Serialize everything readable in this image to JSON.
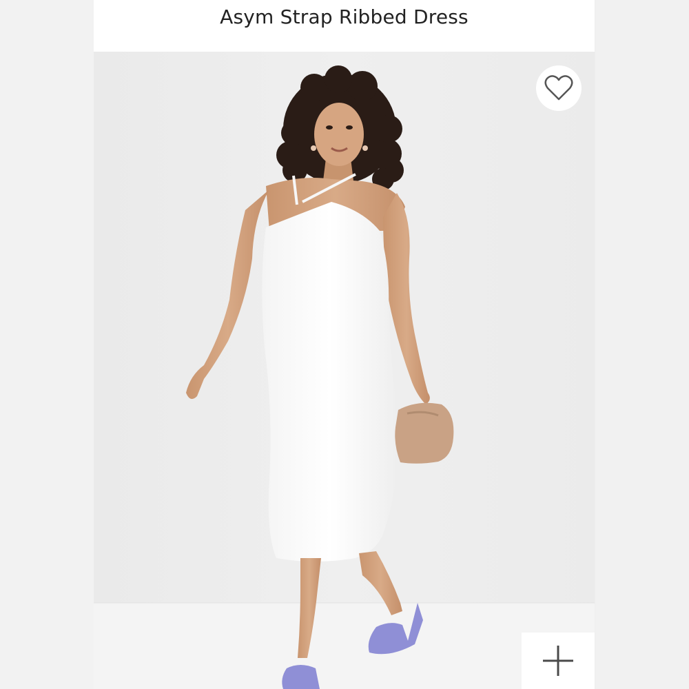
{
  "product": {
    "title": "Asym Strap Ribbed Dress"
  },
  "image": {
    "subject": "model-in-white-dress",
    "alt": ""
  },
  "favorite": {
    "icon": "heart-outline-icon",
    "selected": false
  },
  "zoom": {
    "icon": "plus-icon"
  },
  "colors": {
    "background": "#ececec",
    "card": "#ffffff",
    "title_text": "#222222",
    "icon_stroke": "#555555",
    "dress": "#fafafa",
    "skin": "#d2a07d",
    "hair": "#2a1c16",
    "bag": "#c9a285",
    "shoes": "#8f8fd6"
  }
}
